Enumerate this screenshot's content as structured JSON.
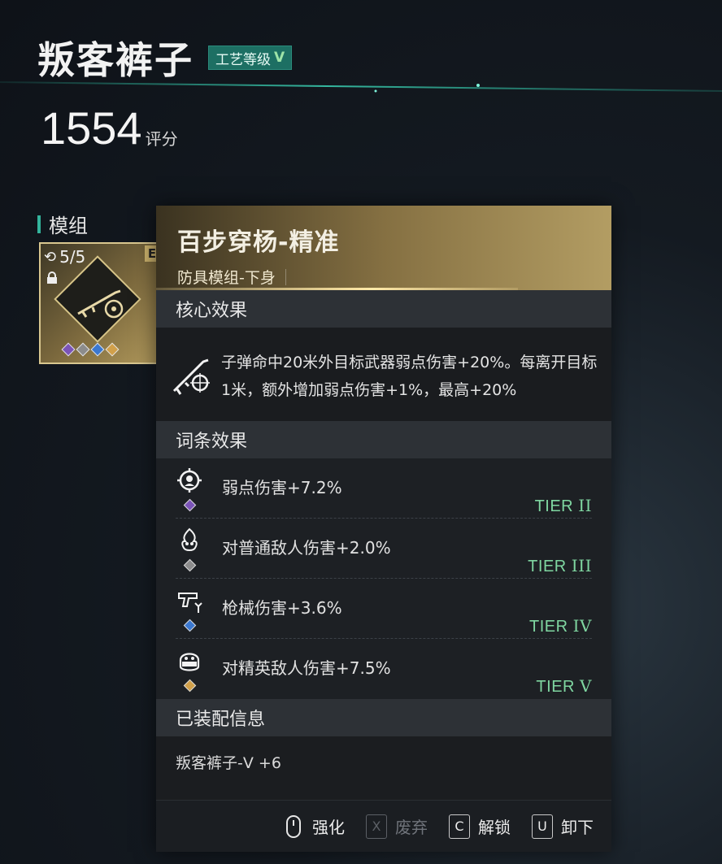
{
  "item": {
    "title": "叛客裤子",
    "craft_label": "工艺等级",
    "craft_level": "V",
    "score": "1554",
    "score_unit": "评分"
  },
  "mods_section": {
    "label": "模组",
    "card": {
      "count": "5/5",
      "corner_badge": "E",
      "dot_colors": [
        "#7b54b8",
        "#8c8c8c",
        "#3b78d0",
        "#d1a04a"
      ]
    }
  },
  "panel": {
    "title": "百步穿杨-精准",
    "subtitle": "防具模组-下身",
    "core": {
      "heading": "核心效果",
      "text": "子弹命中20米外目标武器弱点伤害+20%。每离开目标1米，额外增加弱点伤害+1%，最高+20%"
    },
    "perks": {
      "heading": "词条效果",
      "items": [
        {
          "text": "弱点伤害+7.2%",
          "tier_prefix": "TIER",
          "tier_roman": "II",
          "icon": "crosshair-icon",
          "dot_color": "#7b54b8"
        },
        {
          "text": "对普通敌人伤害+2.0%",
          "tier_prefix": "TIER",
          "tier_roman": "III",
          "icon": "flame-enemy-icon",
          "dot_color": "#8c8c8c"
        },
        {
          "text": "枪械伤害+3.6%",
          "tier_prefix": "TIER",
          "tier_roman": "IV",
          "icon": "gun-burst-icon",
          "dot_color": "#3b78d0"
        },
        {
          "text": "对精英敌人伤害+7.5%",
          "tier_prefix": "TIER",
          "tier_roman": "V",
          "icon": "elite-mask-icon",
          "dot_color": "#d1a04a"
        }
      ]
    },
    "equipped": {
      "heading": "已装配信息",
      "text": "叛客裤子-V +6"
    },
    "actions": {
      "enhance": "强化",
      "discard_key": "X",
      "discard": "废弃",
      "unlock_key": "C",
      "unlock": "解锁",
      "unequip_key": "U",
      "unequip": "卸下"
    }
  },
  "colors": {
    "accent": "#33b49c",
    "tier": "#7fd6a1",
    "gold": "#b39d63"
  }
}
